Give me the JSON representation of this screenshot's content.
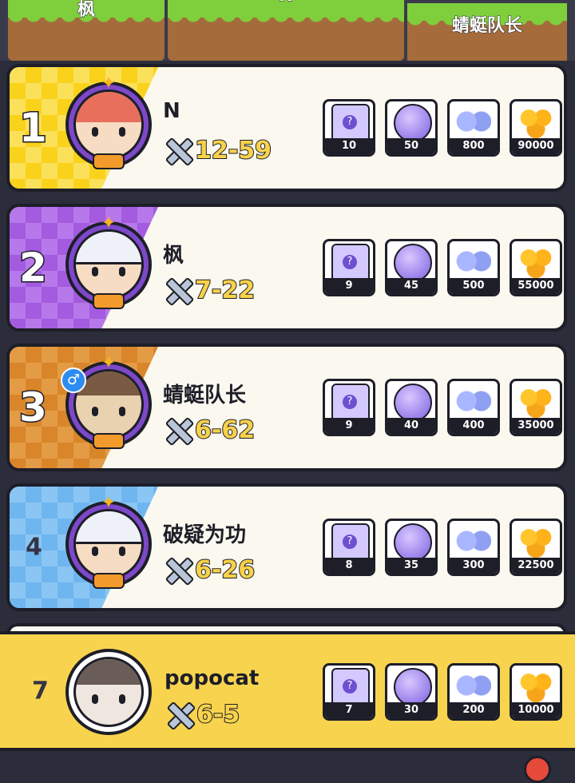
{
  "podium": {
    "left_name": "枫",
    "center_name": "N",
    "right_name": "蜻蜓队长"
  },
  "entries": [
    {
      "rank": "1",
      "name": "N",
      "power": "12-59",
      "band_color": "#f9d21b",
      "has_male_badge": false,
      "rewards": {
        "box": "10",
        "cat_egg": "50",
        "gems": "800",
        "coins": "90000"
      }
    },
    {
      "rank": "2",
      "name": "枫",
      "power": "7-22",
      "band_color": "#a45be0",
      "has_male_badge": false,
      "rewards": {
        "box": "9",
        "cat_egg": "45",
        "gems": "500",
        "coins": "55000"
      }
    },
    {
      "rank": "3",
      "name": "蜻蜓队长",
      "power": "6-62",
      "band_color": "#d9862a",
      "has_male_badge": true,
      "rewards": {
        "box": "9",
        "cat_egg": "40",
        "gems": "400",
        "coins": "35000"
      }
    },
    {
      "rank": "4",
      "name": "破疑为功",
      "power": "6-26",
      "band_color": "#6fb6f0",
      "has_male_badge": false,
      "rewards": {
        "box": "8",
        "cat_egg": "35",
        "gems": "300",
        "coins": "22500"
      }
    }
  ],
  "my_entry": {
    "rank": "7",
    "name": "popocat",
    "power": "6-5",
    "rewards": {
      "box": "7",
      "cat_egg": "30",
      "gems": "200",
      "coins": "10000"
    }
  },
  "badge": {
    "male_symbol": "♂"
  },
  "icons": [
    "mystery-box-icon",
    "cat-egg-icon",
    "gems-icon",
    "coins-icon",
    "sword-icon",
    "star-icon"
  ]
}
